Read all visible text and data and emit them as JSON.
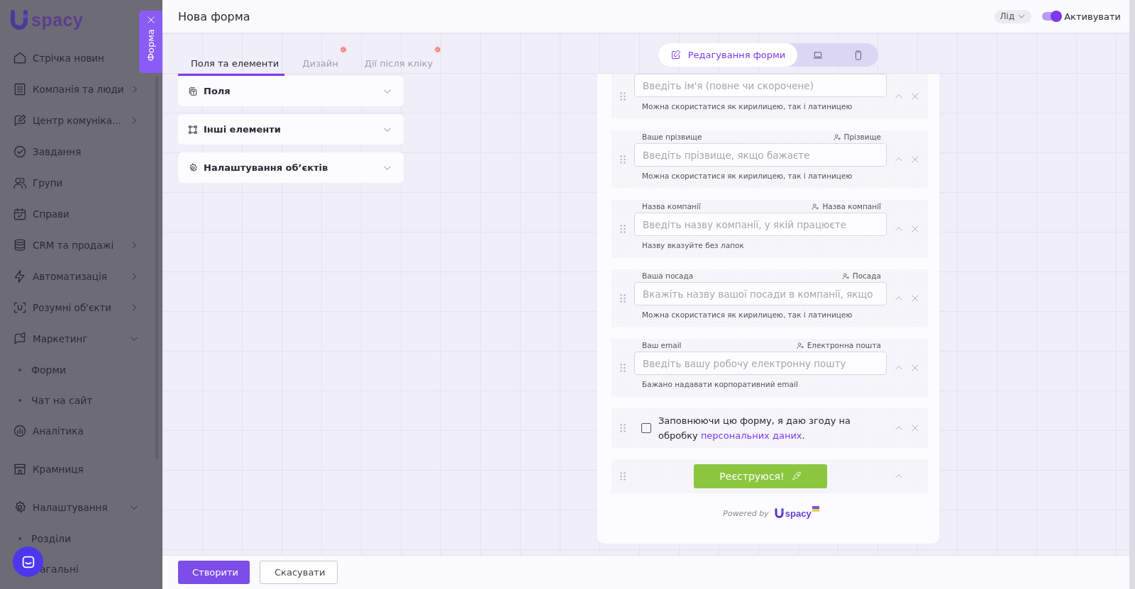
{
  "sidebar": {
    "logo": "spacy",
    "panel_tab": {
      "label": "Форма"
    },
    "items": [
      {
        "label": "Стрічка новин"
      },
      {
        "label": "Компанія та люди",
        "expanded": false
      },
      {
        "label": "Центр комуніка...",
        "expanded": false
      },
      {
        "label": "Завдання"
      },
      {
        "label": "Групи"
      },
      {
        "label": "Справи"
      },
      {
        "label": "CRM та продажі",
        "expanded": false
      },
      {
        "label": "Автоматизація",
        "expanded": false
      },
      {
        "label": "Розумні об'єкти",
        "expanded": false
      },
      {
        "label": "Маркетинг",
        "expanded": true,
        "children": [
          {
            "label": "Форми"
          },
          {
            "label": "Чат на сайт"
          }
        ]
      },
      {
        "label": "Аналітика"
      },
      {
        "label": "Крамниця"
      },
      {
        "label": "Налаштування",
        "expanded": true,
        "children": [
          {
            "label": "Розділи"
          },
          {
            "label": "агальні"
          }
        ]
      }
    ]
  },
  "header": {
    "title": "Нова форма",
    "entity": "Лід",
    "toggle": {
      "label": "Активувати",
      "on": true
    }
  },
  "tabs": [
    {
      "label": "Поля та елементи",
      "selected": true,
      "badge": false
    },
    {
      "label": "Дизайн",
      "selected": false,
      "badge": true
    },
    {
      "label": "Дії після кліку",
      "selected": false,
      "badge": true
    }
  ],
  "sections": [
    {
      "label": "Поля",
      "expanded": false
    },
    {
      "label": "Інші елементи",
      "expanded": false
    },
    {
      "label": "Налаштування об’єктів",
      "expanded": false
    }
  ],
  "view_modes": [
    {
      "kind": "edit",
      "label": "Редагування форми",
      "selected": true
    },
    {
      "kind": "desktop",
      "selected": false
    },
    {
      "kind": "mobile",
      "selected": false
    }
  ],
  "form": {
    "rows": [
      {
        "kind": "field",
        "placeholder": "Введіть ім'я (повне чи скорочене)",
        "hint": "Можна скористатися як кирилицею, так і латиницею",
        "removable": true
      },
      {
        "kind": "field",
        "label": "Ваше прізвище",
        "mapping": "Прізвище",
        "placeholder": "Введіть прізвище, якщо бажаєте",
        "hint": "Можна скористатися як кирилицею, так і латиницею",
        "removable": true
      },
      {
        "kind": "field",
        "label": "Назва компанії",
        "mapping": "Назва компанії",
        "placeholder": "Введіть назву компанії, у якій працюєте",
        "hint": "Назву вказуйте без лапок",
        "removable": true
      },
      {
        "kind": "field",
        "label": "Ваша посада",
        "mapping": "Посада",
        "placeholder": "Вкажіть назву вашої посади в компанії, якщо",
        "hint": "Можна скористатися як кирилицею, так і латиницею",
        "removable": true
      },
      {
        "kind": "field",
        "label": "Ваш email",
        "mapping": "Електронна пошта",
        "placeholder": "Введіть вашу робочу електронну пошту",
        "hint": "Бажано надавати корпоративний email",
        "removable": true
      },
      {
        "kind": "checkbox",
        "checked": false,
        "text": "Заповнюючи цю форму, я даю згоду на обробку ",
        "link": "персональних даних",
        "after": ".",
        "removable": true
      },
      {
        "kind": "button",
        "label": "Реєструюся!",
        "removable": false
      }
    ],
    "powered_by": "Powered by",
    "logo": "spacy"
  },
  "footer": {
    "buttons": [
      {
        "kind": "primary",
        "label": "Створити"
      },
      {
        "kind": "secondary",
        "label": "Скасувати"
      }
    ]
  }
}
